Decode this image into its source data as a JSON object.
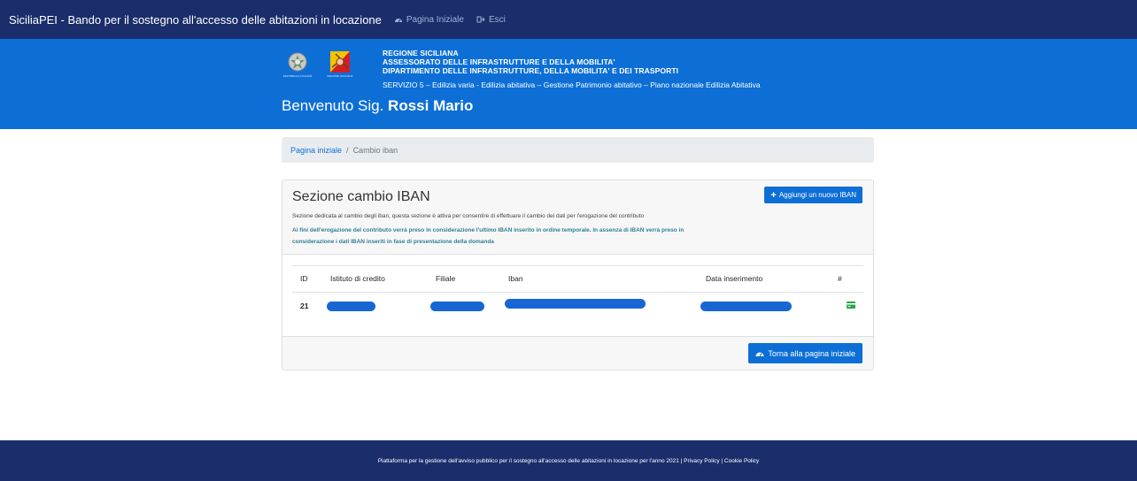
{
  "topbar": {
    "brand": "SiciliaPEI - Bando per il sostegno all'accesso delle abitazioni in locazione",
    "home_label": "Pagina Iniziale",
    "exit_label": "Esci"
  },
  "header": {
    "logo1_caption": "REPUBBLICA ITALIANA",
    "logo2_caption": "REGIONE SICILIANA",
    "org_line1": "REGIONE SICILIANA",
    "org_line2": "ASSESSORATO DELLE INFRASTRUTTURE E DELLA MOBILITA'",
    "org_line3": "DIPARTIMENTO DELLE INFRASTRUTTURE, DELLA MOBILITA' E DEI TRASPORTI",
    "service": "SERVIZIO 5 – Edilizia varia - Edilizia abitativa – Gestione Patrimonio abitativo – Piano nazionale Edilizia Abitativa",
    "welcome_prefix": "Benvenuto Sig.",
    "user_name": "Rossi Mario"
  },
  "breadcrumb": {
    "home": "Pagina iniziale",
    "separator": "/",
    "current": "Cambio iban"
  },
  "card": {
    "title": "Sezione cambio IBAN",
    "add_button": "Aggiungi un nuovo IBAN",
    "description": "Sezione dedicata al cambio degli iban, questa sezione è attiva per consentire di effettuare il cambio dei dati per l'erogazione del contributo",
    "note": "Ai fini dell'erogazione del contributo verrà preso in considerazione l'ultimo IBAN inserito in ordine temporale. In assenza di IBAN verrà preso in considerazione i dati IBAN inseriti in fase di presentazione della domanda",
    "table": {
      "columns": [
        "ID",
        "Istituto di credito",
        "Filiale",
        "Iban",
        "Data inserimento",
        "#"
      ],
      "rows": [
        {
          "id": "21",
          "action_icon": "credit-card-icon"
        }
      ]
    },
    "back_button": "Torna alla pagina iniziale"
  },
  "footer": {
    "text": "Piattaforma per la gestione dell'avviso pubblico per il sostegno all'accesso delle abitazioni in locazione per l'anno 2021 | Privacy Policy | Cookie Policy"
  },
  "colors": {
    "navbar": "#1b2e6b",
    "header": "#0d6fd6",
    "accent": "#0d6fd6",
    "note_text": "#2f7f96",
    "icon_green": "#28a745"
  }
}
